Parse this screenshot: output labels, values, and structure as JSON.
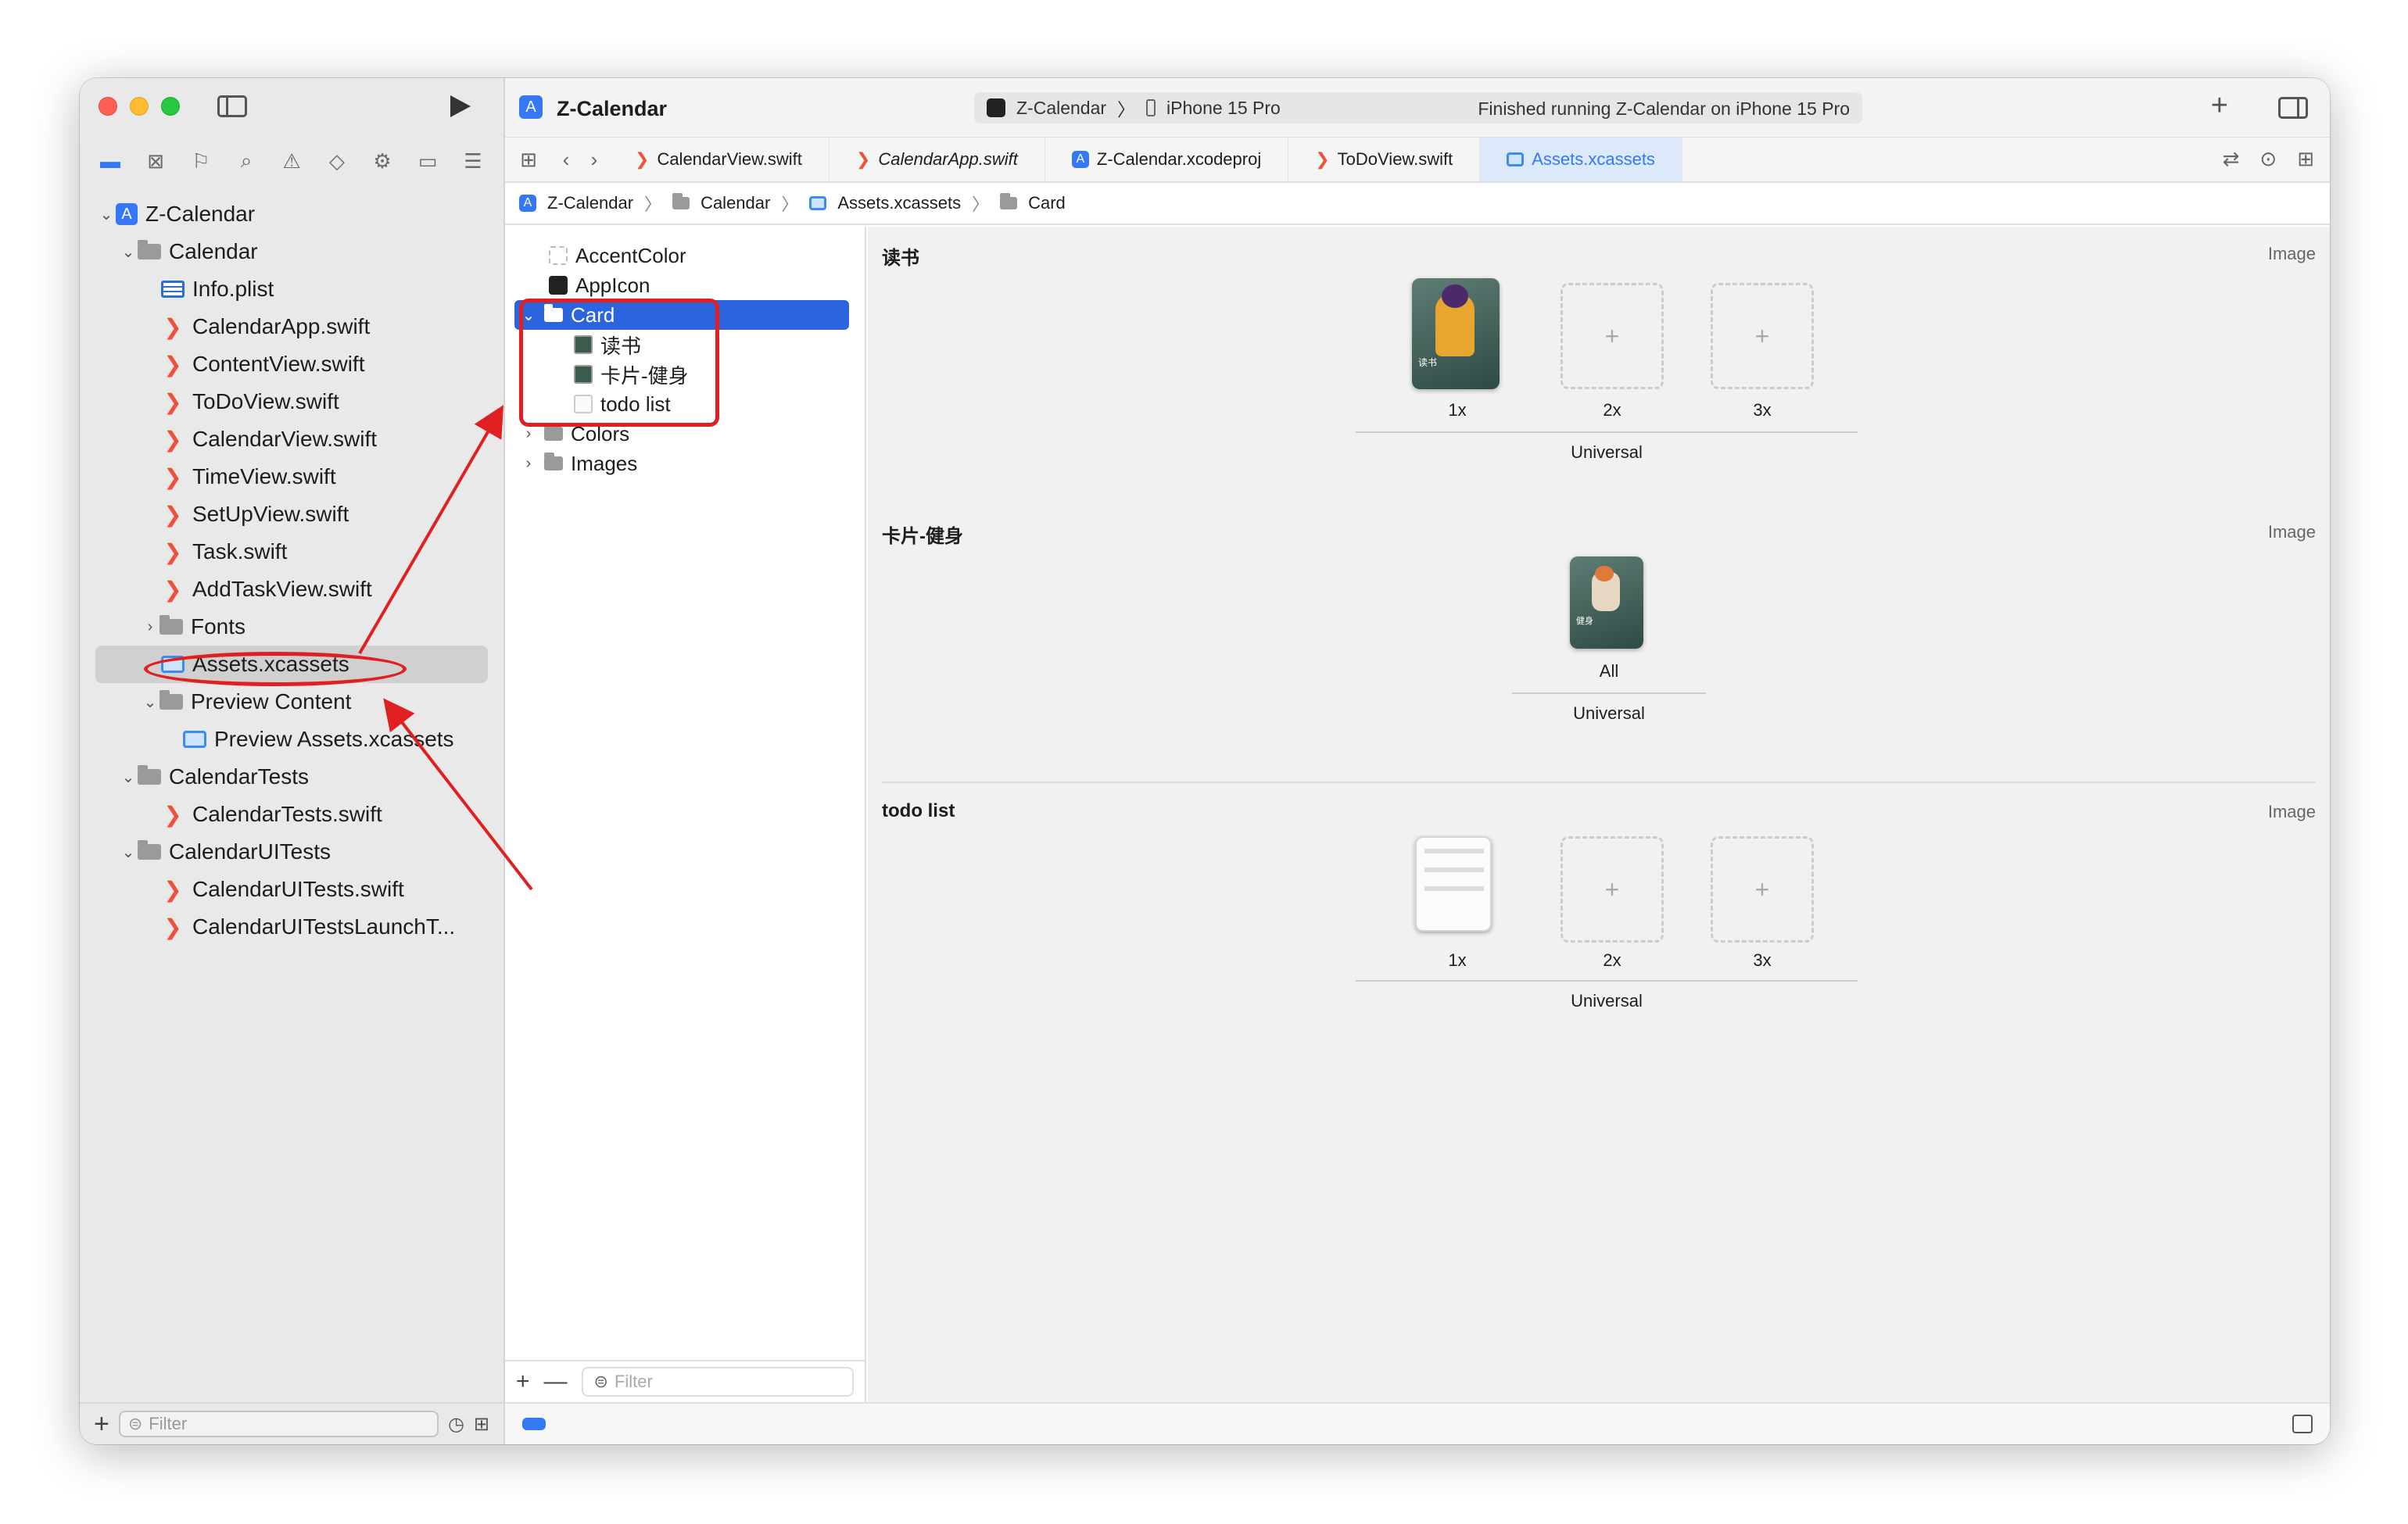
{
  "window": {
    "title": "Z-Calendar"
  },
  "toolbar": {
    "scheme": "Z-Calendar",
    "device": "iPhone 15 Pro",
    "status": "Finished running Z-Calendar on iPhone 15 Pro"
  },
  "navigator": {
    "filter_placeholder": "Filter",
    "tree": [
      {
        "label": "Z-Calendar"
      },
      {
        "label": "Calendar"
      },
      {
        "label": "Info.plist"
      },
      {
        "label": "CalendarApp.swift"
      },
      {
        "label": "ContentView.swift"
      },
      {
        "label": "ToDoView.swift"
      },
      {
        "label": "CalendarView.swift"
      },
      {
        "label": "TimeView.swift"
      },
      {
        "label": "SetUpView.swift"
      },
      {
        "label": "Task.swift"
      },
      {
        "label": "AddTaskView.swift"
      },
      {
        "label": "Fonts"
      },
      {
        "label": "Assets.xcassets"
      },
      {
        "label": "Preview Content"
      },
      {
        "label": "Preview Assets.xcassets"
      },
      {
        "label": "CalendarTests"
      },
      {
        "label": "CalendarTests.swift"
      },
      {
        "label": "CalendarUITests"
      },
      {
        "label": "CalendarUITests.swift"
      },
      {
        "label": "CalendarUITestsLaunchT..."
      }
    ]
  },
  "tabs": [
    {
      "label": "CalendarView.swift"
    },
    {
      "label": "CalendarApp.swift"
    },
    {
      "label": "Z-Calendar.xcodeproj"
    },
    {
      "label": "ToDoView.swift"
    },
    {
      "label": "Assets.xcassets"
    }
  ],
  "breadcrumb": [
    "Z-Calendar",
    "Calendar",
    "Assets.xcassets",
    "Card"
  ],
  "asset_list": {
    "items": [
      {
        "label": "AccentColor"
      },
      {
        "label": "AppIcon"
      },
      {
        "label": "Card"
      },
      {
        "label": "读书"
      },
      {
        "label": "卡片-健身"
      },
      {
        "label": "todo list"
      },
      {
        "label": "Colors"
      },
      {
        "label": "Images"
      }
    ],
    "filter_placeholder": "Filter"
  },
  "asset_sets": [
    {
      "name": "读书",
      "type": "Image",
      "slots": [
        "1x",
        "2x",
        "3x"
      ],
      "group": "Universal",
      "thumb_text": "读书"
    },
    {
      "name": "卡片-健身",
      "type": "Image",
      "slots": [
        "All"
      ],
      "group": "Universal",
      "thumb_text": "健身"
    },
    {
      "name": "todo list",
      "type": "Image",
      "slots": [
        "1x",
        "2x",
        "3x"
      ],
      "group": "Universal"
    }
  ],
  "colors": {
    "accent": "#3478f6",
    "selection": "#2c64de",
    "annotation": "#e02020",
    "swift": "#f05138"
  }
}
